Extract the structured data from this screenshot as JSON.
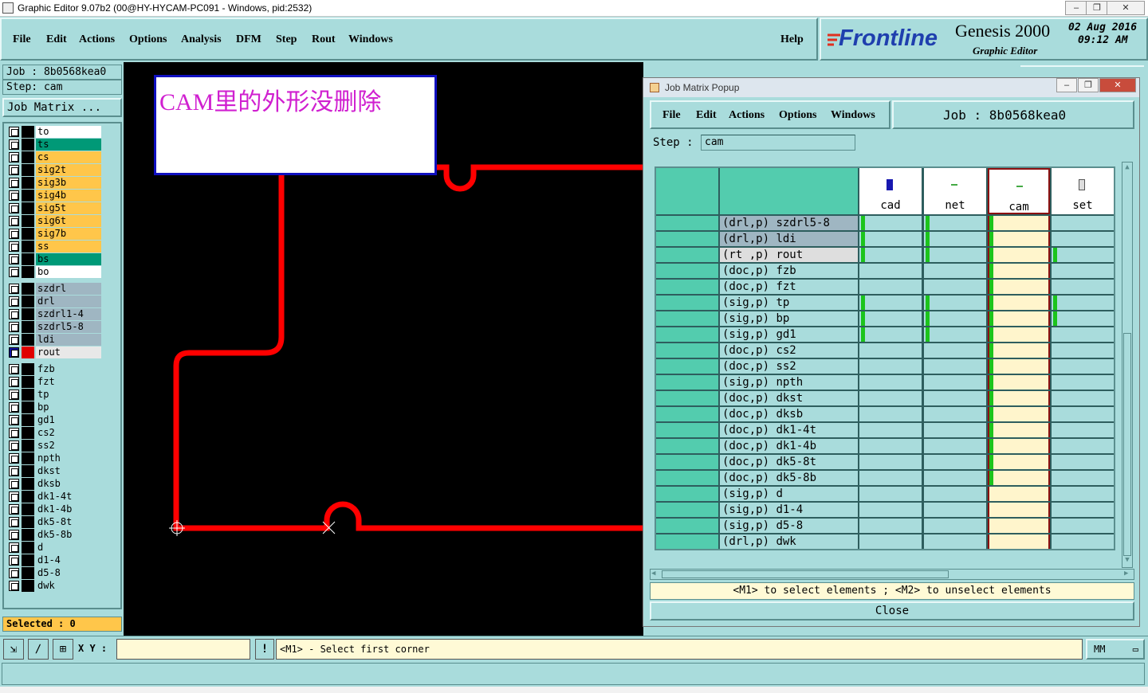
{
  "window": {
    "title": "Graphic Editor 9.07b2 (00@HY-HYCAM-PC091 - Windows, pid:2532)"
  },
  "menu": {
    "file": "File",
    "edit": "Edit",
    "actions": "Actions",
    "options": "Options",
    "analysis": "Analysis",
    "dfm": "DFM",
    "step": "Step",
    "rout": "Rout",
    "windows": "Windows",
    "help": "Help"
  },
  "logo": {
    "brand": "Frontline",
    "product": "Genesis 2000",
    "subtitle": "Graphic Editor",
    "date": "02 Aug 2016",
    "time": "09:12 AM"
  },
  "left": {
    "job": "Job : 8b0568kea0",
    "step": "Step: cam",
    "job_matrix_button": "Job Matrix ...",
    "selected": "Selected : 0"
  },
  "layers_board": [
    {
      "name": "to",
      "color": "#ffffff"
    },
    {
      "name": "ts",
      "color": "#009977"
    },
    {
      "name": "cs",
      "color": "#ffc64a"
    },
    {
      "name": "sig2t",
      "color": "#ffc64a"
    },
    {
      "name": "sig3b",
      "color": "#ffc64a"
    },
    {
      "name": "sig4b",
      "color": "#ffc64a"
    },
    {
      "name": "sig5t",
      "color": "#ffc64a"
    },
    {
      "name": "sig6t",
      "color": "#ffc64a"
    },
    {
      "name": "sig7b",
      "color": "#ffc64a"
    },
    {
      "name": "ss",
      "color": "#ffc64a"
    },
    {
      "name": "bs",
      "color": "#009977"
    },
    {
      "name": "bo",
      "color": "#ffffff"
    }
  ],
  "layers_drill": [
    {
      "name": "szdrl",
      "color": "#9fb6c2"
    },
    {
      "name": "drl",
      "color": "#9fb6c2"
    },
    {
      "name": "szdrl1-4",
      "color": "#9fb6c2"
    },
    {
      "name": "szdrl5-8",
      "color": "#9fb6c2"
    },
    {
      "name": "ldi",
      "color": "#9fb6c2"
    },
    {
      "name": "rout",
      "color": "#e8e8e8"
    }
  ],
  "layers_misc": [
    {
      "name": "fzb"
    },
    {
      "name": "fzt"
    },
    {
      "name": "tp"
    },
    {
      "name": "bp"
    },
    {
      "name": "gd1"
    },
    {
      "name": "cs2"
    },
    {
      "name": "ss2"
    },
    {
      "name": "npth"
    },
    {
      "name": "dkst"
    },
    {
      "name": "dksb"
    },
    {
      "name": "dk1-4t"
    },
    {
      "name": "dk1-4b"
    },
    {
      "name": "dk5-8t"
    },
    {
      "name": "dk5-8b"
    },
    {
      "name": "d"
    },
    {
      "name": "d1-4"
    },
    {
      "name": "d5-8"
    },
    {
      "name": "dwk"
    }
  ],
  "note": {
    "text": "CAM里的外形没删除"
  },
  "bottom": {
    "xy_label": "X Y :",
    "prompt": "<M1> - Select first corner",
    "units": "MM"
  },
  "popup": {
    "title": "Job Matrix Popup",
    "menu": {
      "file": "File",
      "edit": "Edit",
      "actions": "Actions",
      "options": "Options",
      "windows": "Windows"
    },
    "job": "Job : 8b0568kea0",
    "step_label": "Step :",
    "step_value": "cam",
    "columns": [
      "cad",
      "net",
      "cam",
      "set"
    ],
    "rows": [
      {
        "type": "(drl,p)",
        "name": "szdrl5-8",
        "marks": [
          true,
          true,
          true,
          false
        ]
      },
      {
        "type": "(drl,p)",
        "name": "ldi",
        "marks": [
          true,
          true,
          true,
          false
        ]
      },
      {
        "type": "(rt ,p)",
        "name": "rout",
        "marks": [
          true,
          true,
          true,
          true
        ]
      },
      {
        "type": "(doc,p)",
        "name": "fzb",
        "marks": [
          false,
          false,
          true,
          false
        ]
      },
      {
        "type": "(doc,p)",
        "name": "fzt",
        "marks": [
          false,
          false,
          true,
          false
        ]
      },
      {
        "type": "(sig,p)",
        "name": "tp",
        "marks": [
          true,
          true,
          true,
          true
        ]
      },
      {
        "type": "(sig,p)",
        "name": "bp",
        "marks": [
          true,
          true,
          true,
          true
        ]
      },
      {
        "type": "(sig,p)",
        "name": "gd1",
        "marks": [
          true,
          true,
          true,
          false
        ]
      },
      {
        "type": "(doc,p)",
        "name": "cs2",
        "marks": [
          false,
          false,
          true,
          false
        ]
      },
      {
        "type": "(doc,p)",
        "name": "ss2",
        "marks": [
          false,
          false,
          true,
          false
        ]
      },
      {
        "type": "(sig,p)",
        "name": "npth",
        "marks": [
          false,
          false,
          true,
          false
        ]
      },
      {
        "type": "(doc,p)",
        "name": "dkst",
        "marks": [
          false,
          false,
          true,
          false
        ]
      },
      {
        "type": "(doc,p)",
        "name": "dksb",
        "marks": [
          false,
          false,
          true,
          false
        ]
      },
      {
        "type": "(doc,p)",
        "name": "dk1-4t",
        "marks": [
          false,
          false,
          true,
          false
        ]
      },
      {
        "type": "(doc,p)",
        "name": "dk1-4b",
        "marks": [
          false,
          false,
          true,
          false
        ]
      },
      {
        "type": "(doc,p)",
        "name": "dk5-8t",
        "marks": [
          false,
          false,
          true,
          false
        ]
      },
      {
        "type": "(doc,p)",
        "name": "dk5-8b",
        "marks": [
          false,
          false,
          true,
          false
        ]
      },
      {
        "type": "(sig,p)",
        "name": "d",
        "marks": [
          false,
          false,
          false,
          false
        ]
      },
      {
        "type": "(sig,p)",
        "name": "d1-4",
        "marks": [
          false,
          false,
          false,
          false
        ]
      },
      {
        "type": "(sig,p)",
        "name": "d5-8",
        "marks": [
          false,
          false,
          false,
          false
        ]
      },
      {
        "type": "(drl,p)",
        "name": "dwk",
        "marks": [
          false,
          false,
          false,
          false
        ]
      }
    ],
    "hint": "<M1> to select elements ; <M2> to unselect elements",
    "close": "Close"
  }
}
